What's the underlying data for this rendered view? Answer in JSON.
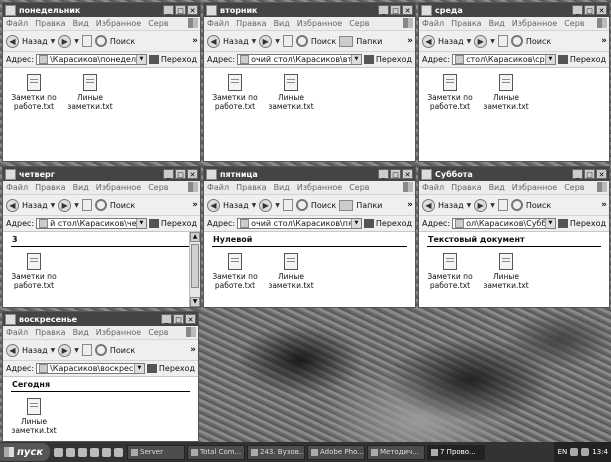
{
  "menu": [
    "Файл",
    "Правка",
    "Вид",
    "Избранное",
    "Серв"
  ],
  "toolbar": {
    "back": "Назад",
    "search": "Поиск",
    "folders": "Папки"
  },
  "address": {
    "label": "Адрес:",
    "go": "Переход"
  },
  "windows": {
    "monday": {
      "title": "понедельник",
      "address": "\\Карасиков\\понедельник",
      "group": "",
      "files": [
        "Заметки по работе.txt",
        "Линые заметки.txt"
      ]
    },
    "tuesday": {
      "title": "вторник",
      "address": "очий стол\\Карасиков\\вторник",
      "group": "",
      "files": [
        "Заметки по работе.txt",
        "Линые заметки.txt"
      ]
    },
    "wednesday": {
      "title": "среда",
      "address": "стол\\Карасиков\\среда",
      "group": "",
      "files": [
        "Заметки по работе.txt",
        "Линые заметки.txt"
      ]
    },
    "thursday": {
      "title": "четверг",
      "address": "й стол\\Карасиков\\четверг",
      "group": "3",
      "files": [
        "Заметки по работе.txt"
      ]
    },
    "friday": {
      "title": "пятница",
      "address": "очий стол\\Карасиков\\пятница",
      "group": "Нулевой",
      "files": [
        "Заметки по работе.txt",
        "Линые заметки.txt"
      ]
    },
    "saturday": {
      "title": "Суббота",
      "address": "ол\\Карасиков\\Суббота",
      "group": "Текстовый документ",
      "files": [
        "Заметки по работе.txt",
        "Линые заметки.txt"
      ]
    },
    "sunday": {
      "title": "воскресенье",
      "address": "\\Карасиков\\воскресенье",
      "group": "Сегодня",
      "files": [
        "Линые заметки.txt"
      ]
    }
  },
  "taskbar": {
    "start": "пуск",
    "buttons": [
      "Server",
      "Total Com...",
      "243. Вузов...",
      "Adobe Pho...",
      "Методич...",
      "7 Прово..."
    ],
    "lang": "EN",
    "clock": "13:4"
  }
}
